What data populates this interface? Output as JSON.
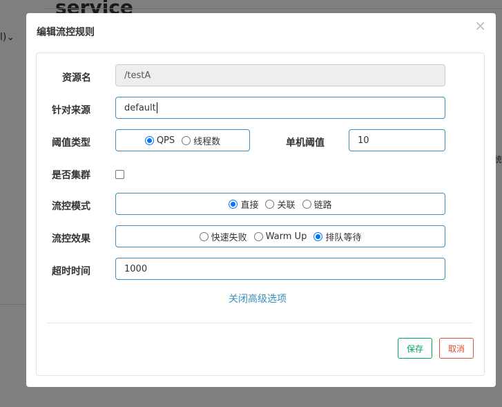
{
  "background": {
    "page_title": "service",
    "left_fragment": "l)⌄",
    "right_fragment": "统"
  },
  "dialog": {
    "title": "编辑流控规则",
    "close_glyph": "×",
    "resource": {
      "label": "资源名",
      "value": "/testA"
    },
    "source": {
      "label": "针对来源",
      "value": "default"
    },
    "threshold_type": {
      "label": "阈值类型",
      "options": [
        "QPS",
        "线程数"
      ],
      "selected": "QPS"
    },
    "single_threshold": {
      "label": "单机阈值",
      "value": "10"
    },
    "cluster": {
      "label": "是否集群",
      "checked": false
    },
    "mode": {
      "label": "流控模式",
      "options": [
        "直接",
        "关联",
        "链路"
      ],
      "selected": "直接"
    },
    "effect": {
      "label": "流控效果",
      "options": [
        "快速失败",
        "Warm Up",
        "排队等待"
      ],
      "selected": "排队等待"
    },
    "timeout": {
      "label": "超时时间",
      "value": "1000"
    },
    "advanced_link": "关闭高级选项",
    "save_label": "保存",
    "cancel_label": "取消"
  },
  "colors": {
    "accent": "#3c8dbc",
    "save": "#00a65a",
    "cancel": "#dd4b39",
    "radio_checked": "#0075ff"
  }
}
